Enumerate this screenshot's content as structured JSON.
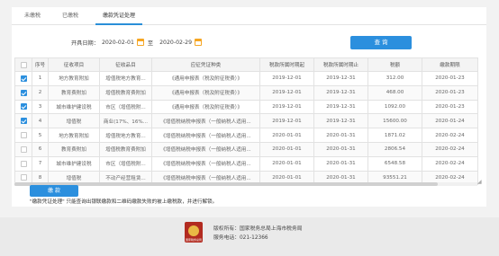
{
  "tabs": [
    {
      "label": "未缴税"
    },
    {
      "label": "已缴税"
    },
    {
      "label": "缴款凭证处理"
    }
  ],
  "filter": {
    "start_label": "开具日期：",
    "start_value": "2020-02-01",
    "separator": "至",
    "end_value": "2020-02-29",
    "query_label": "查  询"
  },
  "table": {
    "headers": [
      "",
      "序号",
      "征收项目",
      "征收品目",
      "应征凭证种类",
      "税款所属时期起",
      "税款所属时期止",
      "税额",
      "缴款期限"
    ],
    "rows": [
      {
        "checked": true,
        "no": "1",
        "item": "地方教育附加",
        "sub": "增值税地方教育...",
        "type": "《通用申报表（税及附征税费）》",
        "from": "2019-12-01",
        "to": "2019-12-31",
        "amount": "312.00",
        "deadline": "2020-01-23"
      },
      {
        "checked": true,
        "no": "2",
        "item": "教育费附加",
        "sub": "增值税教育费附加",
        "type": "《通用申报表（税及附征税费）》",
        "from": "2019-12-01",
        "to": "2019-12-31",
        "amount": "468.00",
        "deadline": "2020-01-23"
      },
      {
        "checked": true,
        "no": "3",
        "item": "城市维护建设税",
        "sub": "市区（增值税附...",
        "type": "《通用申报表（税及附征税费）》",
        "from": "2019-12-01",
        "to": "2019-12-31",
        "amount": "1092.00",
        "deadline": "2020-01-23"
      },
      {
        "checked": true,
        "no": "4",
        "item": "增值税",
        "sub": "商业(17%、16%...",
        "type": "《增值税纳税申报表（一般纳税人适用...",
        "from": "2019-12-01",
        "to": "2019-12-31",
        "amount": "15600.00",
        "deadline": "2020-01-24"
      },
      {
        "checked": false,
        "no": "5",
        "item": "地方教育附加",
        "sub": "增值税地方教育...",
        "type": "《增值税纳税申报表（一般纳税人适用...",
        "from": "2020-01-01",
        "to": "2020-01-31",
        "amount": "1871.02",
        "deadline": "2020-02-24"
      },
      {
        "checked": false,
        "no": "6",
        "item": "教育费附加",
        "sub": "增值税教育费附加",
        "type": "《增值税纳税申报表（一般纳税人适用...",
        "from": "2020-01-01",
        "to": "2020-01-31",
        "amount": "2806.54",
        "deadline": "2020-02-24"
      },
      {
        "checked": false,
        "no": "7",
        "item": "城市维护建设税",
        "sub": "市区（增值税附...",
        "type": "《增值税纳税申报表（一般纳税人适用...",
        "from": "2020-01-01",
        "to": "2020-01-31",
        "amount": "6548.58",
        "deadline": "2020-02-24"
      },
      {
        "checked": false,
        "no": "8",
        "item": "增值税",
        "sub": "不动产经营租赁...",
        "type": "《增值税纳税申报表（一般纳税人适用...",
        "from": "2020-01-01",
        "to": "2020-01-31",
        "amount": "93551.21",
        "deadline": "2020-02-24"
      }
    ]
  },
  "actions": {
    "pay_label": "缴  款"
  },
  "note": "\"缴款凭证处理\" 只能查询出银联缴款和二维码缴款失败的被上缴税款，并进行解锁。",
  "footer": {
    "logo_text": "国家税务总局",
    "copyright": "版权所有：国家税务总局上海市税务局",
    "phone": "服务电话：021-12366"
  },
  "colors": {
    "accent": "#2b8fde",
    "calendar_icon": "#f6a623",
    "logo_red": "#b22b20"
  }
}
